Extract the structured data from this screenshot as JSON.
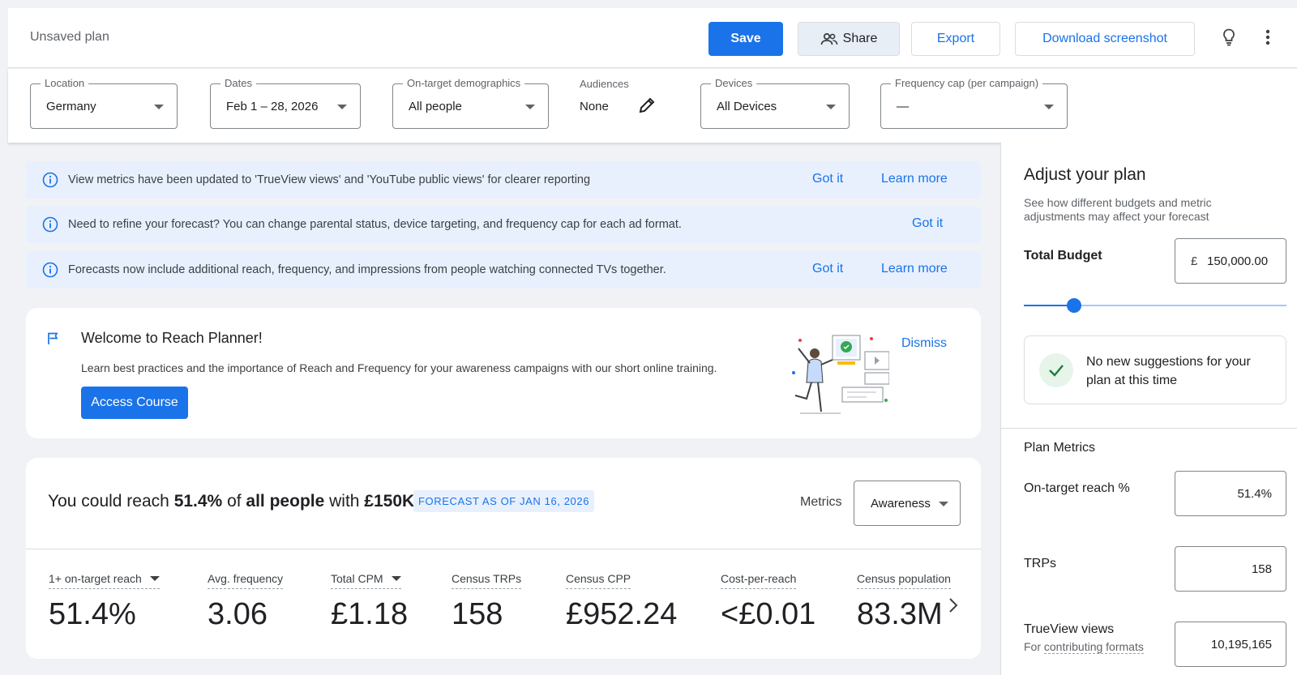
{
  "header": {
    "plan_title": "Unsaved plan",
    "save_label": "Save",
    "share_label": "Share",
    "export_label": "Export",
    "download_label": "Download screenshot",
    "icons": [
      "lightbulb-icon",
      "more-vert-icon",
      "people-icon"
    ]
  },
  "filters": {
    "location": {
      "label": "Location",
      "value": "Germany"
    },
    "dates": {
      "label": "Dates",
      "value": "Feb 1 – 28, 2026"
    },
    "demographics": {
      "label": "On-target demographics",
      "value": "All people"
    },
    "audiences": {
      "label": "Audiences",
      "value": "None"
    },
    "devices": {
      "label": "Devices",
      "value": "All Devices"
    },
    "frequency_cap": {
      "label": "Frequency cap (per campaign)",
      "value": "—"
    }
  },
  "banners": [
    {
      "text": "View metrics have been updated to 'TrueView views' and 'YouTube public views' for clearer reporting",
      "got_it": "Got it",
      "learn_more": "Learn more"
    },
    {
      "text": "Need to refine your forecast? You can change parental status, device targeting, and frequency cap for each ad format.",
      "got_it": "Got it"
    },
    {
      "text": "Forecasts now include additional reach, frequency, and impressions from people watching connected TVs together.",
      "got_it": "Got it",
      "learn_more": "Learn more"
    }
  ],
  "welcome": {
    "title": "Welcome to Reach Planner!",
    "text": "Learn best practices and the importance of Reach and Frequency for your awareness campaigns with our short online training.",
    "course_button": "Access Course",
    "dismiss": "Dismiss"
  },
  "summary": {
    "prefix": "You could reach ",
    "reach": "51.4%",
    "of": " of ",
    "audience": "all people",
    "with": " with ",
    "budget": "£150K",
    "forecast_chip": "FORECAST AS OF JAN 16, 2026",
    "metrics_label": "Metrics",
    "metrics_value": "Awareness",
    "stats": [
      {
        "label": "1+ on-target reach",
        "value": "51.4%"
      },
      {
        "label": "Avg. frequency",
        "value": "3.06"
      },
      {
        "label": "Total CPM",
        "value": "£1.18"
      },
      {
        "label": "Census TRPs",
        "value": "158"
      },
      {
        "label": "Census CPP",
        "value": "£952.24"
      },
      {
        "label": "Cost-per-reach",
        "value": "<£0.01"
      },
      {
        "label": "Census population",
        "value": "83.3M"
      }
    ]
  },
  "panel": {
    "title": "Adjust your plan",
    "subtitle": "See how different budgets and metric adjustments may affect your forecast",
    "budget_label": "Total Budget",
    "currency": "£",
    "budget_value": "150,000.00",
    "slider_level": 0.19,
    "suggestion": "No new suggestions for your plan at this time",
    "metrics_title": "Plan Metrics",
    "reach_label": "On-target reach %",
    "reach_value": "51.4%",
    "trps_label": "TRPs",
    "trps_value": "158",
    "trueview_label": "TrueView views",
    "trueview_sub_prefix": "For ",
    "trueview_sub_link": "contributing formats",
    "trueview_value": "10,195,165"
  },
  "colors": {
    "accent": "#1a73e8",
    "banner_bg": "#e8f0fe",
    "page_bg": "#f0f2f5"
  }
}
